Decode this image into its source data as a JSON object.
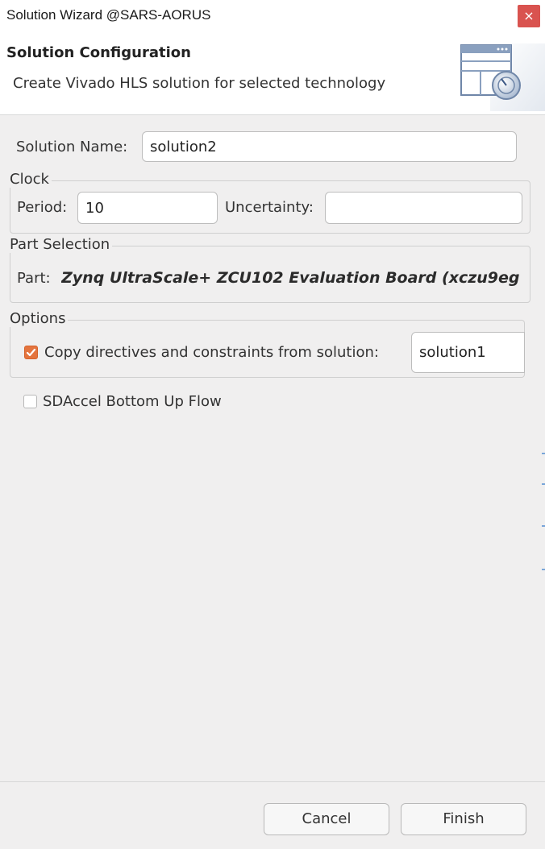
{
  "window": {
    "title": "Solution Wizard @SARS-AORUS",
    "close_glyph": "×"
  },
  "header": {
    "title": "Solution Configuration",
    "subtitle": "Create Vivado HLS solution for selected technology"
  },
  "form": {
    "solution_name_label": "Solution Name:",
    "solution_name_value": "solution2",
    "clock": {
      "group_label": "Clock",
      "period_label": "Period:",
      "period_value": "10",
      "uncertainty_label": "Uncertainty:",
      "uncertainty_value": ""
    },
    "part_selection": {
      "group_label": "Part Selection",
      "part_label": "Part:",
      "part_value": "Zynq UltraScale+ ZCU102 Evaluation Board (xczu9eg"
    },
    "options": {
      "group_label": "Options",
      "copy_directives_label": "Copy directives and constraints from solution:",
      "copy_directives_checked": true,
      "source_solution": "solution1"
    },
    "sdaccel_label": "SDAccel Bottom Up Flow",
    "sdaccel_checked": false
  },
  "buttons": {
    "cancel": "Cancel",
    "finish": "Finish"
  },
  "colors": {
    "checkbox_accent": "#e4743e",
    "close_button": "#d9534f"
  }
}
